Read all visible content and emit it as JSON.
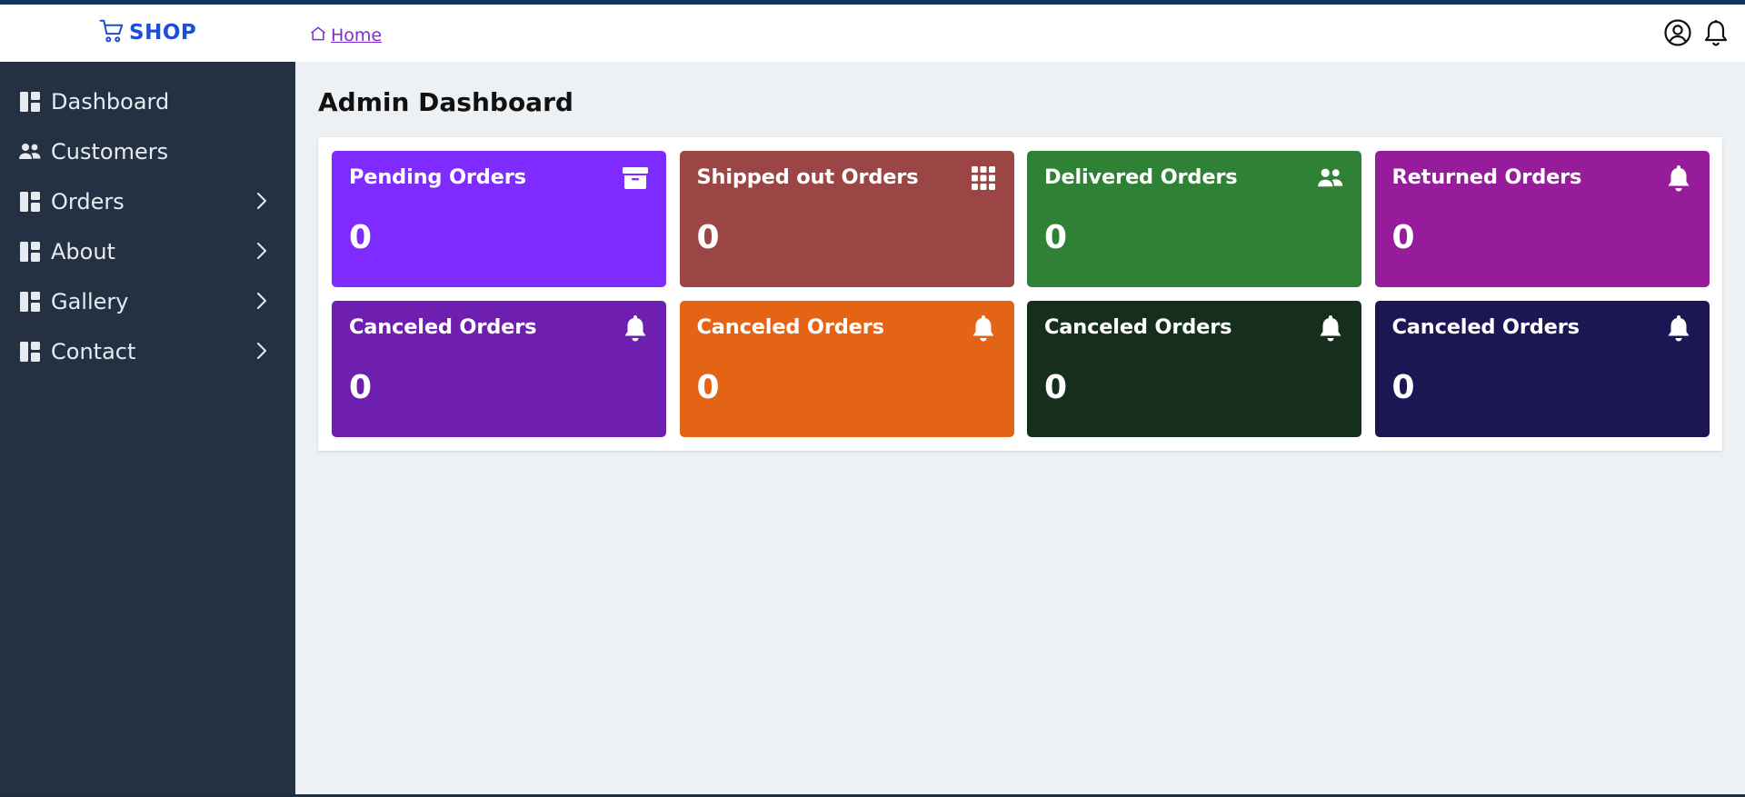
{
  "header": {
    "logo_text": "SHOP",
    "breadcrumb_home": "Home"
  },
  "sidebar": {
    "items": [
      {
        "label": "Dashboard",
        "icon": "dashboard-icon",
        "has_chevron": false
      },
      {
        "label": "Customers",
        "icon": "users-icon",
        "has_chevron": false
      },
      {
        "label": "Orders",
        "icon": "dashboard-icon",
        "has_chevron": true
      },
      {
        "label": "About",
        "icon": "dashboard-icon",
        "has_chevron": true
      },
      {
        "label": "Gallery",
        "icon": "dashboard-icon",
        "has_chevron": true
      },
      {
        "label": "Contact",
        "icon": "dashboard-icon",
        "has_chevron": true
      }
    ]
  },
  "main": {
    "title": "Admin Dashboard",
    "cards": [
      {
        "title": "Pending Orders",
        "value": "0",
        "color": "#7e2bff",
        "icon": "archive-icon"
      },
      {
        "title": "Shipped out Orders",
        "value": "0",
        "color": "#9b4545",
        "icon": "grid-icon"
      },
      {
        "title": "Delivered Orders",
        "value": "0",
        "color": "#2f8135",
        "icon": "users-icon"
      },
      {
        "title": "Returned Orders",
        "value": "0",
        "color": "#971c9c",
        "icon": "bell-icon"
      },
      {
        "title": "Canceled Orders",
        "value": "0",
        "color": "#6f1fb0",
        "icon": "bell-icon"
      },
      {
        "title": "Canceled Orders",
        "value": "0",
        "color": "#e36414",
        "icon": "bell-icon"
      },
      {
        "title": "Canceled Orders",
        "value": "0",
        "color": "#162f1d",
        "icon": "bell-icon"
      },
      {
        "title": "Canceled Orders",
        "value": "0",
        "color": "#1c1654",
        "icon": "bell-icon"
      }
    ]
  },
  "colors": {
    "sidebar_bg": "#243142",
    "header_bg": "#ffffff",
    "page_bg": "#eef1f4",
    "brand": "#1d4ed8",
    "link": "#7c2bd4"
  }
}
